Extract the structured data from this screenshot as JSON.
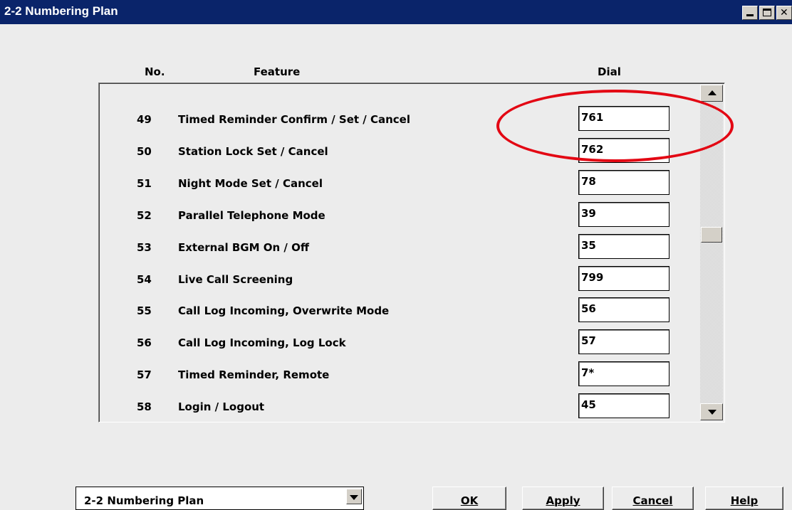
{
  "window": {
    "title": "2-2 Numbering Plan"
  },
  "table": {
    "headers": {
      "no": "No.",
      "feature": "Feature",
      "dial": "Dial"
    },
    "rows": [
      {
        "no": "49",
        "feature": "Timed Reminder Confirm / Set / Cancel",
        "dial": "761"
      },
      {
        "no": "50",
        "feature": "Station Lock Set / Cancel",
        "dial": "762"
      },
      {
        "no": "51",
        "feature": "Night Mode Set / Cancel",
        "dial": "78"
      },
      {
        "no": "52",
        "feature": "Parallel Telephone Mode",
        "dial": "39"
      },
      {
        "no": "53",
        "feature": "External BGM On / Off",
        "dial": "35"
      },
      {
        "no": "54",
        "feature": "Live Call Screening",
        "dial": "799"
      },
      {
        "no": "55",
        "feature": "Call Log Incoming, Overwrite Mode",
        "dial": "56"
      },
      {
        "no": "56",
        "feature": "Call Log Incoming, Log Lock",
        "dial": "57"
      },
      {
        "no": "57",
        "feature": "Timed Reminder, Remote",
        "dial": "7*"
      },
      {
        "no": "58",
        "feature": "Login / Logout",
        "dial": "45"
      }
    ]
  },
  "footer": {
    "page_select": "2-2 Numbering Plan",
    "ok_label": "OK",
    "apply_label": "Apply",
    "cancel_label": "Cancel",
    "help_label": "Help"
  },
  "colors": {
    "titlebar": "#0a246a",
    "highlight": "#e30613"
  },
  "icons": [
    "minimize-icon",
    "maximize-icon",
    "close-icon",
    "scroll-up-icon",
    "scroll-down-icon",
    "chevron-down-icon"
  ]
}
